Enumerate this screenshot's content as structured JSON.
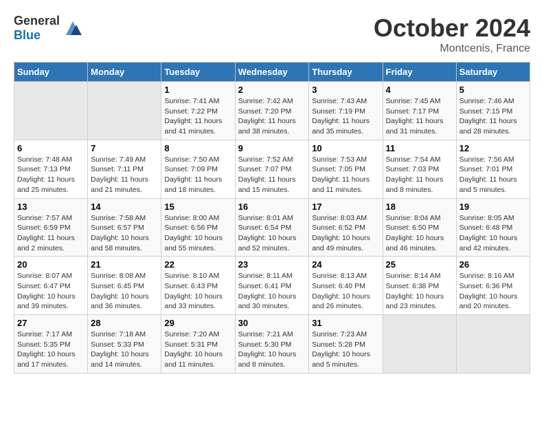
{
  "header": {
    "logo_general": "General",
    "logo_blue": "Blue",
    "month": "October 2024",
    "location": "Montcenis, France"
  },
  "calendar": {
    "columns": [
      "Sunday",
      "Monday",
      "Tuesday",
      "Wednesday",
      "Thursday",
      "Friday",
      "Saturday"
    ],
    "rows": [
      [
        {
          "day": "",
          "empty": true
        },
        {
          "day": "",
          "empty": true
        },
        {
          "day": "1",
          "sunrise": "Sunrise: 7:41 AM",
          "sunset": "Sunset: 7:22 PM",
          "daylight": "Daylight: 11 hours and 41 minutes."
        },
        {
          "day": "2",
          "sunrise": "Sunrise: 7:42 AM",
          "sunset": "Sunset: 7:20 PM",
          "daylight": "Daylight: 11 hours and 38 minutes."
        },
        {
          "day": "3",
          "sunrise": "Sunrise: 7:43 AM",
          "sunset": "Sunset: 7:19 PM",
          "daylight": "Daylight: 11 hours and 35 minutes."
        },
        {
          "day": "4",
          "sunrise": "Sunrise: 7:45 AM",
          "sunset": "Sunset: 7:17 PM",
          "daylight": "Daylight: 11 hours and 31 minutes."
        },
        {
          "day": "5",
          "sunrise": "Sunrise: 7:46 AM",
          "sunset": "Sunset: 7:15 PM",
          "daylight": "Daylight: 11 hours and 28 minutes."
        }
      ],
      [
        {
          "day": "6",
          "sunrise": "Sunrise: 7:48 AM",
          "sunset": "Sunset: 7:13 PM",
          "daylight": "Daylight: 11 hours and 25 minutes."
        },
        {
          "day": "7",
          "sunrise": "Sunrise: 7:49 AM",
          "sunset": "Sunset: 7:11 PM",
          "daylight": "Daylight: 11 hours and 21 minutes."
        },
        {
          "day": "8",
          "sunrise": "Sunrise: 7:50 AM",
          "sunset": "Sunset: 7:09 PM",
          "daylight": "Daylight: 11 hours and 18 minutes."
        },
        {
          "day": "9",
          "sunrise": "Sunrise: 7:52 AM",
          "sunset": "Sunset: 7:07 PM",
          "daylight": "Daylight: 11 hours and 15 minutes."
        },
        {
          "day": "10",
          "sunrise": "Sunrise: 7:53 AM",
          "sunset": "Sunset: 7:05 PM",
          "daylight": "Daylight: 11 hours and 11 minutes."
        },
        {
          "day": "11",
          "sunrise": "Sunrise: 7:54 AM",
          "sunset": "Sunset: 7:03 PM",
          "daylight": "Daylight: 11 hours and 8 minutes."
        },
        {
          "day": "12",
          "sunrise": "Sunrise: 7:56 AM",
          "sunset": "Sunset: 7:01 PM",
          "daylight": "Daylight: 11 hours and 5 minutes."
        }
      ],
      [
        {
          "day": "13",
          "sunrise": "Sunrise: 7:57 AM",
          "sunset": "Sunset: 6:59 PM",
          "daylight": "Daylight: 11 hours and 2 minutes."
        },
        {
          "day": "14",
          "sunrise": "Sunrise: 7:58 AM",
          "sunset": "Sunset: 6:57 PM",
          "daylight": "Daylight: 10 hours and 58 minutes."
        },
        {
          "day": "15",
          "sunrise": "Sunrise: 8:00 AM",
          "sunset": "Sunset: 6:56 PM",
          "daylight": "Daylight: 10 hours and 55 minutes."
        },
        {
          "day": "16",
          "sunrise": "Sunrise: 8:01 AM",
          "sunset": "Sunset: 6:54 PM",
          "daylight": "Daylight: 10 hours and 52 minutes."
        },
        {
          "day": "17",
          "sunrise": "Sunrise: 8:03 AM",
          "sunset": "Sunset: 6:52 PM",
          "daylight": "Daylight: 10 hours and 49 minutes."
        },
        {
          "day": "18",
          "sunrise": "Sunrise: 8:04 AM",
          "sunset": "Sunset: 6:50 PM",
          "daylight": "Daylight: 10 hours and 46 minutes."
        },
        {
          "day": "19",
          "sunrise": "Sunrise: 8:05 AM",
          "sunset": "Sunset: 6:48 PM",
          "daylight": "Daylight: 10 hours and 42 minutes."
        }
      ],
      [
        {
          "day": "20",
          "sunrise": "Sunrise: 8:07 AM",
          "sunset": "Sunset: 6:47 PM",
          "daylight": "Daylight: 10 hours and 39 minutes."
        },
        {
          "day": "21",
          "sunrise": "Sunrise: 8:08 AM",
          "sunset": "Sunset: 6:45 PM",
          "daylight": "Daylight: 10 hours and 36 minutes."
        },
        {
          "day": "22",
          "sunrise": "Sunrise: 8:10 AM",
          "sunset": "Sunset: 6:43 PM",
          "daylight": "Daylight: 10 hours and 33 minutes."
        },
        {
          "day": "23",
          "sunrise": "Sunrise: 8:11 AM",
          "sunset": "Sunset: 6:41 PM",
          "daylight": "Daylight: 10 hours and 30 minutes."
        },
        {
          "day": "24",
          "sunrise": "Sunrise: 8:13 AM",
          "sunset": "Sunset: 6:40 PM",
          "daylight": "Daylight: 10 hours and 26 minutes."
        },
        {
          "day": "25",
          "sunrise": "Sunrise: 8:14 AM",
          "sunset": "Sunset: 6:38 PM",
          "daylight": "Daylight: 10 hours and 23 minutes."
        },
        {
          "day": "26",
          "sunrise": "Sunrise: 8:16 AM",
          "sunset": "Sunset: 6:36 PM",
          "daylight": "Daylight: 10 hours and 20 minutes."
        }
      ],
      [
        {
          "day": "27",
          "sunrise": "Sunrise: 7:17 AM",
          "sunset": "Sunset: 5:35 PM",
          "daylight": "Daylight: 10 hours and 17 minutes."
        },
        {
          "day": "28",
          "sunrise": "Sunrise: 7:18 AM",
          "sunset": "Sunset: 5:33 PM",
          "daylight": "Daylight: 10 hours and 14 minutes."
        },
        {
          "day": "29",
          "sunrise": "Sunrise: 7:20 AM",
          "sunset": "Sunset: 5:31 PM",
          "daylight": "Daylight: 10 hours and 11 minutes."
        },
        {
          "day": "30",
          "sunrise": "Sunrise: 7:21 AM",
          "sunset": "Sunset: 5:30 PM",
          "daylight": "Daylight: 10 hours and 8 minutes."
        },
        {
          "day": "31",
          "sunrise": "Sunrise: 7:23 AM",
          "sunset": "Sunset: 5:28 PM",
          "daylight": "Daylight: 10 hours and 5 minutes."
        },
        {
          "day": "",
          "empty": true
        },
        {
          "day": "",
          "empty": true
        }
      ]
    ]
  }
}
